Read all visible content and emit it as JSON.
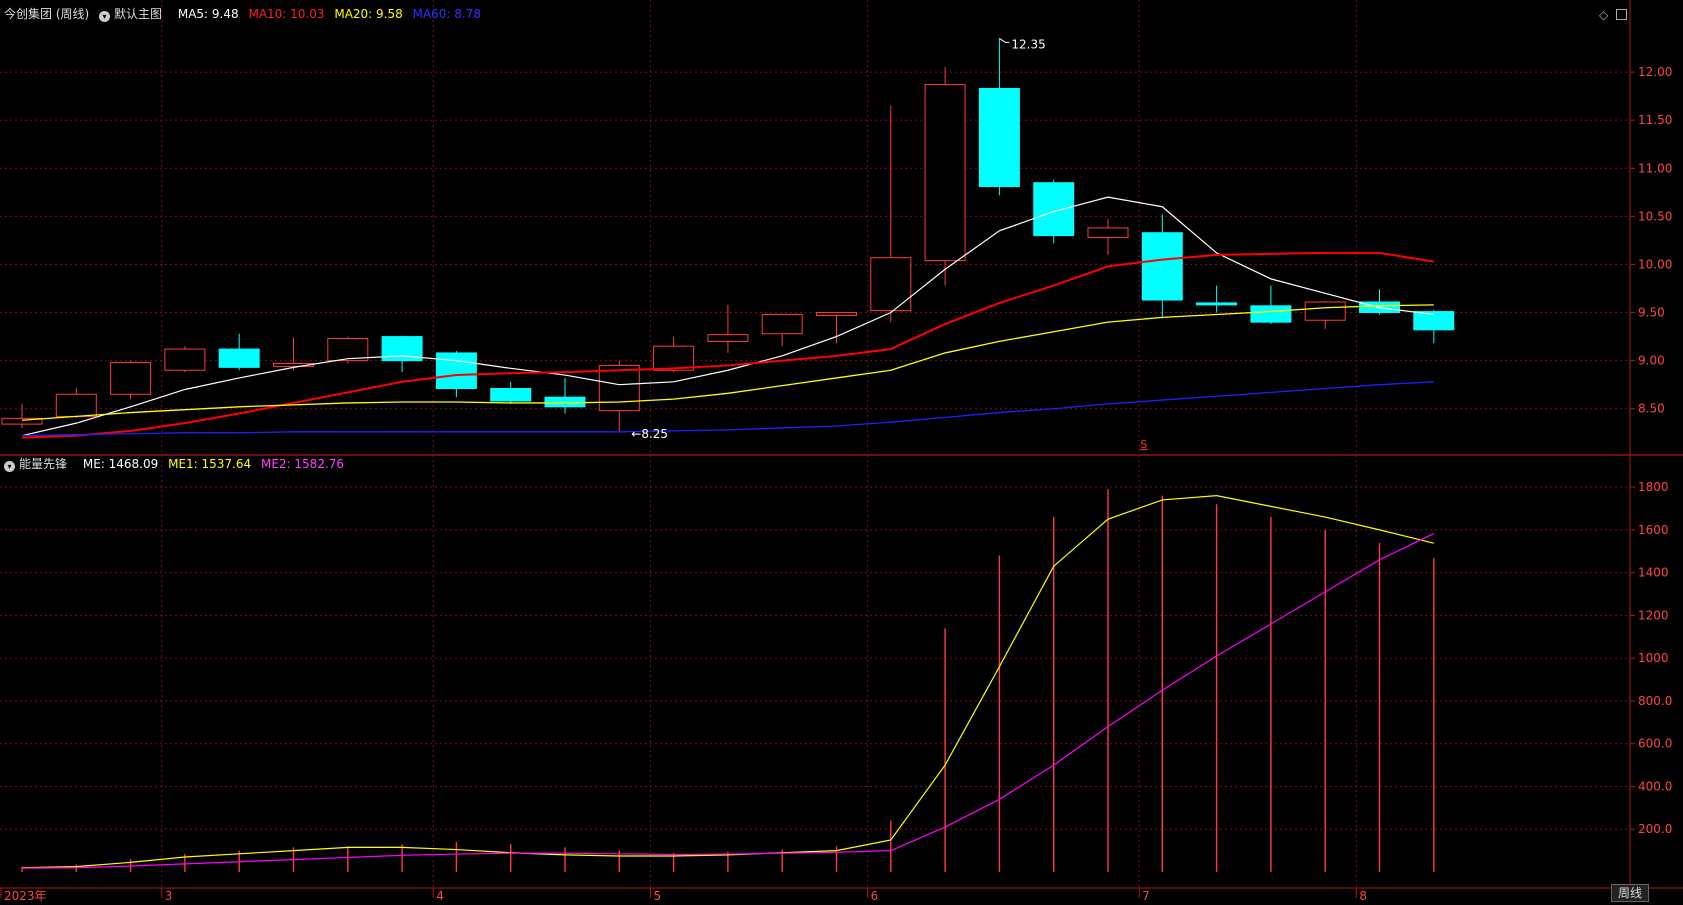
{
  "header": {
    "stock_name": "今创集团 (周线)",
    "main_chart_label": "默认主图",
    "ma5_label": "MA5: 9.48",
    "ma10_label": "MA10: 10.03",
    "ma20_label": "MA20: 9.58",
    "ma60_label": "MA60: 8.78"
  },
  "indicator": {
    "name": "能量先锋",
    "me_label": "ME: 1468.09",
    "me1_label": "ME1: 1537.64",
    "me2_label": "ME2: 1582.76"
  },
  "period_button": "周线",
  "colors": {
    "up": "#ff3b3b",
    "down": "#00ffff",
    "ma5": "#ffffff",
    "ma10": "#ff0000",
    "ma20": "#ffff00",
    "ma60": "#2020ff",
    "me1": "#ffff00",
    "me2": "#ff00ff",
    "grid": "#7a1010",
    "axis": "#b01818",
    "label": "#ff4444"
  },
  "chart_data": [
    {
      "type": "candlestick",
      "title": "今创集团 (周线)",
      "ylim": [
        8.05,
        12.5
      ],
      "yticks": [
        "8.50",
        "9.00",
        "9.50",
        "10.00",
        "10.50",
        "11.00",
        "11.50",
        "12.00"
      ],
      "x_labels": [
        {
          "index": 0,
          "text": "2023年"
        },
        {
          "index": 3,
          "text": "3"
        },
        {
          "index": 8,
          "text": "4"
        },
        {
          "index": 12,
          "text": "5"
        },
        {
          "index": 16,
          "text": "6"
        },
        {
          "index": 21,
          "text": "7"
        },
        {
          "index": 25,
          "text": "8"
        }
      ],
      "candles": [
        {
          "o": 8.34,
          "h": 8.55,
          "l": 8.3,
          "c": 8.4
        },
        {
          "o": 8.42,
          "h": 8.72,
          "l": 8.4,
          "c": 8.65
        },
        {
          "o": 8.65,
          "h": 9.0,
          "l": 8.6,
          "c": 8.98
        },
        {
          "o": 8.9,
          "h": 9.15,
          "l": 8.88,
          "c": 9.12
        },
        {
          "o": 9.12,
          "h": 9.28,
          "l": 8.9,
          "c": 8.93
        },
        {
          "o": 8.94,
          "h": 9.24,
          "l": 8.9,
          "c": 8.97
        },
        {
          "o": 9.0,
          "h": 9.25,
          "l": 8.97,
          "c": 9.23
        },
        {
          "o": 9.25,
          "h": 9.26,
          "l": 8.88,
          "c": 9.0
        },
        {
          "o": 9.08,
          "h": 9.1,
          "l": 8.62,
          "c": 8.71
        },
        {
          "o": 8.71,
          "h": 8.78,
          "l": 8.55,
          "c": 8.58
        },
        {
          "o": 8.62,
          "h": 8.82,
          "l": 8.45,
          "c": 8.52
        },
        {
          "o": 8.48,
          "h": 9.0,
          "l": 8.25,
          "c": 8.95
        },
        {
          "o": 8.9,
          "h": 9.25,
          "l": 8.88,
          "c": 9.15
        },
        {
          "o": 9.2,
          "h": 9.58,
          "l": 9.08,
          "c": 9.27
        },
        {
          "o": 9.28,
          "h": 9.48,
          "l": 9.15,
          "c": 9.48
        },
        {
          "o": 9.47,
          "h": 9.5,
          "l": 9.18,
          "c": 9.5
        },
        {
          "o": 9.52,
          "h": 11.65,
          "l": 9.4,
          "c": 10.07
        },
        {
          "o": 10.04,
          "h": 12.05,
          "l": 9.78,
          "c": 11.87
        },
        {
          "o": 11.83,
          "h": 12.35,
          "l": 10.72,
          "c": 10.81
        },
        {
          "o": 10.85,
          "h": 10.88,
          "l": 10.22,
          "c": 10.3
        },
        {
          "o": 10.28,
          "h": 10.47,
          "l": 10.1,
          "c": 10.38
        },
        {
          "o": 10.33,
          "h": 10.52,
          "l": 9.44,
          "c": 9.63
        },
        {
          "o": 9.6,
          "h": 9.78,
          "l": 9.5,
          "c": 9.58
        },
        {
          "o": 9.57,
          "h": 9.78,
          "l": 9.38,
          "c": 9.4
        },
        {
          "o": 9.42,
          "h": 9.62,
          "l": 9.33,
          "c": 9.61
        },
        {
          "o": 9.61,
          "h": 9.74,
          "l": 9.48,
          "c": 9.5
        },
        {
          "o": 9.51,
          "h": 9.53,
          "l": 9.18,
          "c": 9.32
        }
      ],
      "series": [
        {
          "name": "MA5",
          "values": [
            8.22,
            8.35,
            8.52,
            8.7,
            8.82,
            8.93,
            9.02,
            9.05,
            9.0,
            8.92,
            8.85,
            8.75,
            8.78,
            8.9,
            9.05,
            9.25,
            9.5,
            9.95,
            10.35,
            10.55,
            10.7,
            10.6,
            10.12,
            9.85,
            9.7,
            9.55,
            9.48
          ]
        },
        {
          "name": "MA10",
          "values": [
            8.2,
            8.22,
            8.27,
            8.35,
            8.45,
            8.56,
            8.67,
            8.78,
            8.85,
            8.87,
            8.88,
            8.9,
            8.92,
            8.95,
            9.0,
            9.05,
            9.12,
            9.38,
            9.6,
            9.78,
            9.98,
            10.05,
            10.1,
            10.11,
            10.12,
            10.12,
            10.03
          ]
        },
        {
          "name": "MA20",
          "values": [
            8.38,
            8.42,
            8.46,
            8.49,
            8.52,
            8.54,
            8.56,
            8.57,
            8.57,
            8.56,
            8.56,
            8.57,
            8.6,
            8.66,
            8.74,
            8.82,
            8.9,
            9.08,
            9.2,
            9.3,
            9.4,
            9.45,
            9.48,
            9.51,
            9.55,
            9.57,
            9.58
          ]
        },
        {
          "name": "MA60",
          "values": [
            8.22,
            8.23,
            8.24,
            8.25,
            8.25,
            8.26,
            8.26,
            8.26,
            8.26,
            8.26,
            8.26,
            8.26,
            8.27,
            8.28,
            8.3,
            8.32,
            8.36,
            8.41,
            8.46,
            8.5,
            8.55,
            8.59,
            8.63,
            8.67,
            8.71,
            8.75,
            8.78
          ]
        }
      ],
      "annotations": [
        {
          "index": 18,
          "value": 12.35,
          "text": "12.35"
        },
        {
          "index": 11,
          "value": 8.25,
          "text": "8.25"
        },
        {
          "index": 21,
          "text": "S"
        }
      ]
    },
    {
      "type": "bar+line",
      "title": "能量先锋",
      "ylim": [
        0,
        1880
      ],
      "yticks": [
        "200.0",
        "400.0",
        "600.0",
        "800.0",
        "1000",
        "1200",
        "1400",
        "1600",
        "1800"
      ],
      "series": [
        {
          "name": "ME",
          "values": [
            25,
            35,
            60,
            85,
            100,
            115,
            120,
            130,
            140,
            130,
            115,
            100,
            90,
            95,
            105,
            120,
            240,
            1140,
            1480,
            1660,
            1790,
            1760,
            1720,
            1660,
            1600,
            1540,
            1468
          ]
        },
        {
          "name": "ME1",
          "values": [
            20,
            25,
            45,
            70,
            85,
            100,
            115,
            115,
            105,
            90,
            80,
            75,
            75,
            80,
            90,
            100,
            150,
            500,
            960,
            1430,
            1650,
            1740,
            1760,
            1710,
            1660,
            1600,
            1537.64
          ]
        },
        {
          "name": "ME2",
          "values": [
            18,
            20,
            28,
            38,
            48,
            58,
            68,
            78,
            84,
            88,
            88,
            85,
            82,
            84,
            88,
            92,
            100,
            210,
            340,
            500,
            680,
            850,
            1010,
            1160,
            1310,
            1460,
            1582.76
          ]
        }
      ]
    }
  ]
}
